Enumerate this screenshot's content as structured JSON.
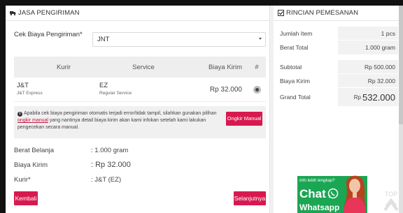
{
  "left_panel": {
    "title": "JASA PENGIRIMAN",
    "cek_label": "Cek Biaya Pengiriman*",
    "courier_select": "JNT",
    "table": {
      "headers": [
        "Kurir",
        "Service",
        "Biaya Kirim",
        "#"
      ],
      "rows": [
        {
          "kurir": "J&T",
          "kurir_sub": "J&T Express",
          "service": "EZ",
          "service_sub": "Regular Service",
          "biaya": "Rp 32.000",
          "selected": true
        }
      ]
    },
    "notice": {
      "text_before": "Apabila cek biaya pengiriman otomatis terjadi error/tidak tampil, silahkan gunakan pilihan ",
      "link": "ongkir manual",
      "text_after": " yang nantinya detail biaya kirim akan kami infokan setelah kami lakukan pengecekan secara manual.",
      "button": "Ongkir Manual"
    },
    "summary": [
      {
        "label": "Berat Belanja",
        "value": ": 1.000 gram"
      },
      {
        "label": "Biaya Kirim",
        "value": ": Rp 32.000"
      },
      {
        "label": "Kurir*",
        "value": ": J&T (EZ)"
      }
    ],
    "back_button": "Kembali",
    "next_button": "Selanjutnya"
  },
  "right_panel": {
    "title": "RINCIAN PEMESANAN",
    "rows_a": [
      {
        "label": "Jumlah Item",
        "value": "1 pcs"
      },
      {
        "label": "Berat Total",
        "value": "1.000 gram"
      }
    ],
    "rows_b": [
      {
        "label": "Subtotal",
        "value": "Rp 500.000"
      },
      {
        "label": "Biaya Kirim",
        "value": "Rp 32.000"
      },
      {
        "label": "Grand Total",
        "value_prefix": "Rp",
        "value": "532.000"
      }
    ]
  },
  "whatsapp_widget": {
    "teaser": "Info lebih lengkap?",
    "chat": "Chat",
    "app": "Whatsapp"
  },
  "top_button": "TOP",
  "colors": {
    "accent": "#d7194f",
    "whatsapp_green": "#1aa653"
  }
}
